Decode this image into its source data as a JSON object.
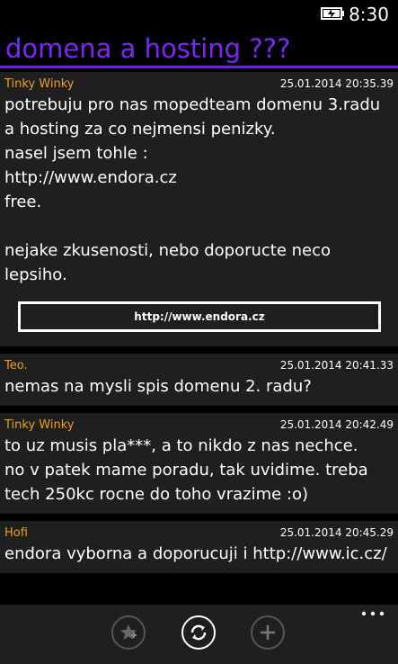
{
  "status": {
    "time": "8:30"
  },
  "page": {
    "title": "domena a hosting ???"
  },
  "posts": [
    {
      "author": "Tinky Winky",
      "date": "25.01.2014 20:35.39",
      "body": "potrebuju pro nas mopedteam domenu 3.radu a hosting za co nejmensi penizky.\nnasel jsem tohle :\nhttp://www.endora.cz\nfree.\n\nnejake zkusenosti, nebo doporucte neco lepsiho.",
      "link": "http://www.endora.cz"
    },
    {
      "author": "Teo.",
      "date": "25.01.2014 20:41.33",
      "body": "nemas na mysli spis domenu 2. radu?"
    },
    {
      "author": "Tinky Winky",
      "date": "25.01.2014 20:42.49",
      "body": "to uz musis pla***, a to nikdo z nas nechce.\nno v patek mame poradu, tak uvidime. treba tech 250kc rocne do toho vrazime :o)"
    },
    {
      "author": "Hofi",
      "date": "25.01.2014 20:45.29",
      "body": "endora vyborna a doporucuji i http://www.ic.cz/"
    }
  ],
  "appbar": {
    "buttons": [
      "favorite-add",
      "refresh",
      "add"
    ]
  },
  "colors": {
    "accent": "#6a22e0",
    "author": "#f0a30a",
    "card": "#1f1f1f"
  }
}
